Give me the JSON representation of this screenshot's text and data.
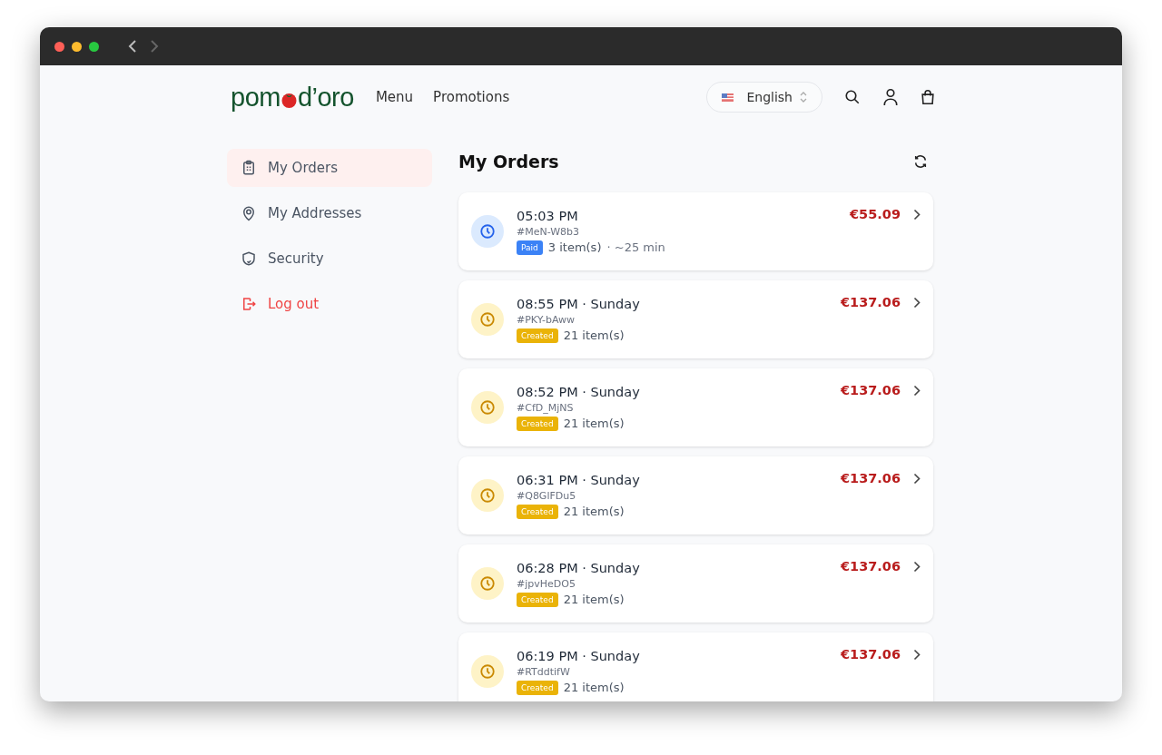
{
  "header": {
    "logo": {
      "before": "pom",
      "after": "d’oro"
    },
    "nav": [
      "Menu",
      "Promotions"
    ],
    "language": "English"
  },
  "sidebar": {
    "items": [
      {
        "label": "My Orders",
        "kind": "orders",
        "selected": true
      },
      {
        "label": "My Addresses",
        "kind": "addresses",
        "selected": false
      },
      {
        "label": "Security",
        "kind": "security",
        "selected": false
      },
      {
        "label": "Log out",
        "kind": "logout",
        "selected": false
      }
    ]
  },
  "main": {
    "title": "My Orders",
    "orders": [
      {
        "time": "05:03 PM",
        "id": "#MeN-W8b3",
        "status": "Paid",
        "kind": "paid",
        "items": "3 item(s)",
        "eta": "· ~25 min",
        "total": "€55.09"
      },
      {
        "time": "08:55 PM · Sunday",
        "id": "#PKY-bAww",
        "status": "Created",
        "kind": "created",
        "items": "21 item(s)",
        "total": "€137.06"
      },
      {
        "time": "08:52 PM · Sunday",
        "id": "#CfD_MjNS",
        "status": "Created",
        "kind": "created",
        "items": "21 item(s)",
        "total": "€137.06"
      },
      {
        "time": "06:31 PM · Sunday",
        "id": "#Q8GlFDu5",
        "status": "Created",
        "kind": "created",
        "items": "21 item(s)",
        "total": "€137.06"
      },
      {
        "time": "06:28 PM · Sunday",
        "id": "#jpvHeDO5",
        "status": "Created",
        "kind": "created",
        "items": "21 item(s)",
        "total": "€137.06"
      },
      {
        "time": "06:19 PM · Sunday",
        "id": "#RTddtifW",
        "status": "Created",
        "kind": "created",
        "items": "21 item(s)",
        "total": "€137.06"
      }
    ]
  }
}
